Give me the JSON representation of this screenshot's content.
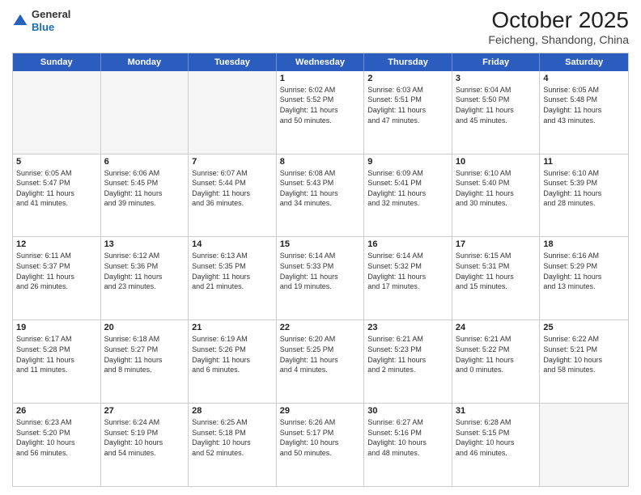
{
  "header": {
    "logo_general": "General",
    "logo_blue": "Blue",
    "month_title": "October 2025",
    "location": "Feicheng, Shandong, China"
  },
  "days_of_week": [
    "Sunday",
    "Monday",
    "Tuesday",
    "Wednesday",
    "Thursday",
    "Friday",
    "Saturday"
  ],
  "rows": [
    [
      {
        "day": "",
        "text": "",
        "shaded": true
      },
      {
        "day": "",
        "text": "",
        "shaded": true
      },
      {
        "day": "",
        "text": "",
        "shaded": true
      },
      {
        "day": "1",
        "text": "Sunrise: 6:02 AM\nSunset: 5:52 PM\nDaylight: 11 hours\nand 50 minutes.",
        "shaded": false
      },
      {
        "day": "2",
        "text": "Sunrise: 6:03 AM\nSunset: 5:51 PM\nDaylight: 11 hours\nand 47 minutes.",
        "shaded": false
      },
      {
        "day": "3",
        "text": "Sunrise: 6:04 AM\nSunset: 5:50 PM\nDaylight: 11 hours\nand 45 minutes.",
        "shaded": false
      },
      {
        "day": "4",
        "text": "Sunrise: 6:05 AM\nSunset: 5:48 PM\nDaylight: 11 hours\nand 43 minutes.",
        "shaded": false
      }
    ],
    [
      {
        "day": "5",
        "text": "Sunrise: 6:05 AM\nSunset: 5:47 PM\nDaylight: 11 hours\nand 41 minutes.",
        "shaded": false
      },
      {
        "day": "6",
        "text": "Sunrise: 6:06 AM\nSunset: 5:45 PM\nDaylight: 11 hours\nand 39 minutes.",
        "shaded": false
      },
      {
        "day": "7",
        "text": "Sunrise: 6:07 AM\nSunset: 5:44 PM\nDaylight: 11 hours\nand 36 minutes.",
        "shaded": false
      },
      {
        "day": "8",
        "text": "Sunrise: 6:08 AM\nSunset: 5:43 PM\nDaylight: 11 hours\nand 34 minutes.",
        "shaded": false
      },
      {
        "day": "9",
        "text": "Sunrise: 6:09 AM\nSunset: 5:41 PM\nDaylight: 11 hours\nand 32 minutes.",
        "shaded": false
      },
      {
        "day": "10",
        "text": "Sunrise: 6:10 AM\nSunset: 5:40 PM\nDaylight: 11 hours\nand 30 minutes.",
        "shaded": false
      },
      {
        "day": "11",
        "text": "Sunrise: 6:10 AM\nSunset: 5:39 PM\nDaylight: 11 hours\nand 28 minutes.",
        "shaded": false
      }
    ],
    [
      {
        "day": "12",
        "text": "Sunrise: 6:11 AM\nSunset: 5:37 PM\nDaylight: 11 hours\nand 26 minutes.",
        "shaded": false
      },
      {
        "day": "13",
        "text": "Sunrise: 6:12 AM\nSunset: 5:36 PM\nDaylight: 11 hours\nand 23 minutes.",
        "shaded": false
      },
      {
        "day": "14",
        "text": "Sunrise: 6:13 AM\nSunset: 5:35 PM\nDaylight: 11 hours\nand 21 minutes.",
        "shaded": false
      },
      {
        "day": "15",
        "text": "Sunrise: 6:14 AM\nSunset: 5:33 PM\nDaylight: 11 hours\nand 19 minutes.",
        "shaded": false
      },
      {
        "day": "16",
        "text": "Sunrise: 6:14 AM\nSunset: 5:32 PM\nDaylight: 11 hours\nand 17 minutes.",
        "shaded": false
      },
      {
        "day": "17",
        "text": "Sunrise: 6:15 AM\nSunset: 5:31 PM\nDaylight: 11 hours\nand 15 minutes.",
        "shaded": false
      },
      {
        "day": "18",
        "text": "Sunrise: 6:16 AM\nSunset: 5:29 PM\nDaylight: 11 hours\nand 13 minutes.",
        "shaded": false
      }
    ],
    [
      {
        "day": "19",
        "text": "Sunrise: 6:17 AM\nSunset: 5:28 PM\nDaylight: 11 hours\nand 11 minutes.",
        "shaded": false
      },
      {
        "day": "20",
        "text": "Sunrise: 6:18 AM\nSunset: 5:27 PM\nDaylight: 11 hours\nand 8 minutes.",
        "shaded": false
      },
      {
        "day": "21",
        "text": "Sunrise: 6:19 AM\nSunset: 5:26 PM\nDaylight: 11 hours\nand 6 minutes.",
        "shaded": false
      },
      {
        "day": "22",
        "text": "Sunrise: 6:20 AM\nSunset: 5:25 PM\nDaylight: 11 hours\nand 4 minutes.",
        "shaded": false
      },
      {
        "day": "23",
        "text": "Sunrise: 6:21 AM\nSunset: 5:23 PM\nDaylight: 11 hours\nand 2 minutes.",
        "shaded": false
      },
      {
        "day": "24",
        "text": "Sunrise: 6:21 AM\nSunset: 5:22 PM\nDaylight: 11 hours\nand 0 minutes.",
        "shaded": false
      },
      {
        "day": "25",
        "text": "Sunrise: 6:22 AM\nSunset: 5:21 PM\nDaylight: 10 hours\nand 58 minutes.",
        "shaded": false
      }
    ],
    [
      {
        "day": "26",
        "text": "Sunrise: 6:23 AM\nSunset: 5:20 PM\nDaylight: 10 hours\nand 56 minutes.",
        "shaded": false
      },
      {
        "day": "27",
        "text": "Sunrise: 6:24 AM\nSunset: 5:19 PM\nDaylight: 10 hours\nand 54 minutes.",
        "shaded": false
      },
      {
        "day": "28",
        "text": "Sunrise: 6:25 AM\nSunset: 5:18 PM\nDaylight: 10 hours\nand 52 minutes.",
        "shaded": false
      },
      {
        "day": "29",
        "text": "Sunrise: 6:26 AM\nSunset: 5:17 PM\nDaylight: 10 hours\nand 50 minutes.",
        "shaded": false
      },
      {
        "day": "30",
        "text": "Sunrise: 6:27 AM\nSunset: 5:16 PM\nDaylight: 10 hours\nand 48 minutes.",
        "shaded": false
      },
      {
        "day": "31",
        "text": "Sunrise: 6:28 AM\nSunset: 5:15 PM\nDaylight: 10 hours\nand 46 minutes.",
        "shaded": false
      },
      {
        "day": "",
        "text": "",
        "shaded": true
      }
    ]
  ]
}
